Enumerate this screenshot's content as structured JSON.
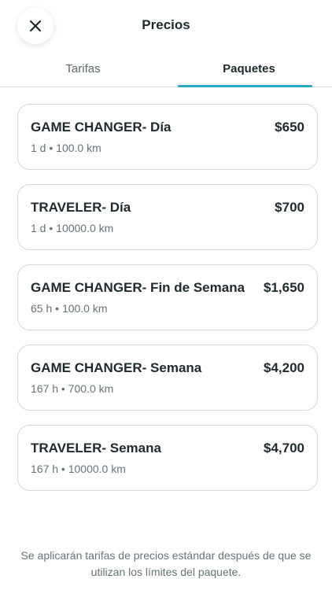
{
  "header": {
    "title": "Precios",
    "close_icon": "close-icon"
  },
  "tabs": [
    {
      "label": "Tarifas",
      "active": false
    },
    {
      "label": "Paquetes",
      "active": true
    }
  ],
  "accent_color": "#2aa6c8",
  "packages": [
    {
      "name": "GAME CHANGER- Día",
      "price": "$650",
      "duration": "1 d",
      "distance": "100.0 km"
    },
    {
      "name": "TRAVELER- Día",
      "price": "$700",
      "duration": "1 d",
      "distance": "10000.0 km"
    },
    {
      "name": "GAME CHANGER- Fin de Semana",
      "price": "$1,650",
      "duration": "65 h",
      "distance": "100.0 km"
    },
    {
      "name": "GAME CHANGER- Semana",
      "price": "$4,200",
      "duration": "167 h",
      "distance": "700.0 km"
    },
    {
      "name": "TRAVELER- Semana",
      "price": "$4,700",
      "duration": "167 h",
      "distance": "10000.0 km"
    }
  ],
  "footer_note": "Se aplicarán tarifas de precios estándar después de que se utilizan los límites del paquete."
}
